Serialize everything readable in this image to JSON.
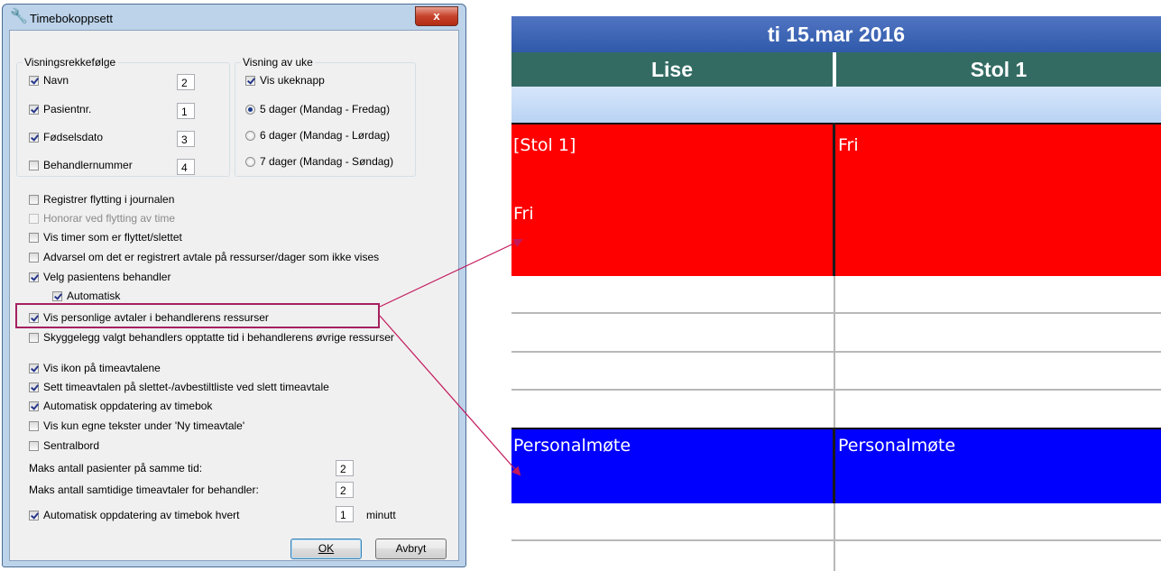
{
  "dialog": {
    "title": "Timebokoppsett",
    "close_label": "x",
    "group1": {
      "title": "Visningsrekkefølge",
      "items": [
        {
          "label": "Navn",
          "checked": true,
          "value": "2"
        },
        {
          "label": "Pasientnr.",
          "checked": true,
          "value": "1"
        },
        {
          "label": "Fødselsdato",
          "checked": true,
          "value": "3"
        },
        {
          "label": "Behandlernummer",
          "checked": false,
          "value": "4"
        }
      ]
    },
    "group2": {
      "title": "Visning av uke",
      "checkbox_label": "Vis ukeknapp",
      "radios": [
        {
          "label": "5 dager (Mandag - Fredag)",
          "checked": true
        },
        {
          "label": "6 dager (Mandag - Lørdag)",
          "checked": false
        },
        {
          "label": "7 dager (Mandag - Søndag)",
          "checked": false
        }
      ]
    },
    "options": [
      {
        "label": "Registrer flytting i journalen",
        "checked": false
      },
      {
        "label": "Honorar ved flytting av time",
        "checked": false,
        "disabled": true
      },
      {
        "label": "Vis timer som er flyttet/slettet",
        "checked": false
      },
      {
        "label": "Advarsel om det er registrert avtale på ressurser/dager som ikke vises",
        "checked": false
      },
      {
        "label": "Velg pasientens behandler",
        "checked": true
      },
      {
        "label": "Automatisk",
        "checked": true
      },
      {
        "label": "Vis personlige avtaler i behandlerens ressurser",
        "checked": true
      },
      {
        "label": "Skyggelegg valgt behandlers opptatte tid i behandlerens øvrige ressurser",
        "checked": false
      },
      {
        "label": "Vis ikon på timeavtalene",
        "checked": true
      },
      {
        "label": "Sett timeavtalen på slettet-/avbestiltliste ved slett timeavtale",
        "checked": true
      },
      {
        "label": "Automatisk oppdatering av timebok",
        "checked": true
      },
      {
        "label": "Vis kun egne tekster under 'Ny timeavtale'",
        "checked": false
      },
      {
        "label": "Sentralbord",
        "checked": false
      }
    ],
    "fields": {
      "max_patients_label": "Maks antall pasienter på samme tid:",
      "max_patients_value": "2",
      "max_concurrent_label": "Maks antall samtidige timeavtaler for behandler:",
      "max_concurrent_value": "2",
      "auto_update_label": "Automatisk oppdatering av timebok hvert",
      "auto_update_value": "1",
      "auto_update_unit": "minutt"
    },
    "buttons": {
      "ok": "OK",
      "cancel": "Avbryt"
    }
  },
  "schedule": {
    "date": "ti 15.mar 2016",
    "columns": [
      "Lise",
      "Stol 1"
    ],
    "red_block": {
      "left_label": "[Stol 1]",
      "left_status": "Fri",
      "right_status": "Fri",
      "color": "#ff0000"
    },
    "blue_block": {
      "left_label": "Personalmøte",
      "right_label": "Personalmøte",
      "color": "#0000ff"
    },
    "header_color": "#336b63",
    "date_bar_color": "#3a63b4"
  },
  "annotation": {
    "color": "#c2185b"
  }
}
